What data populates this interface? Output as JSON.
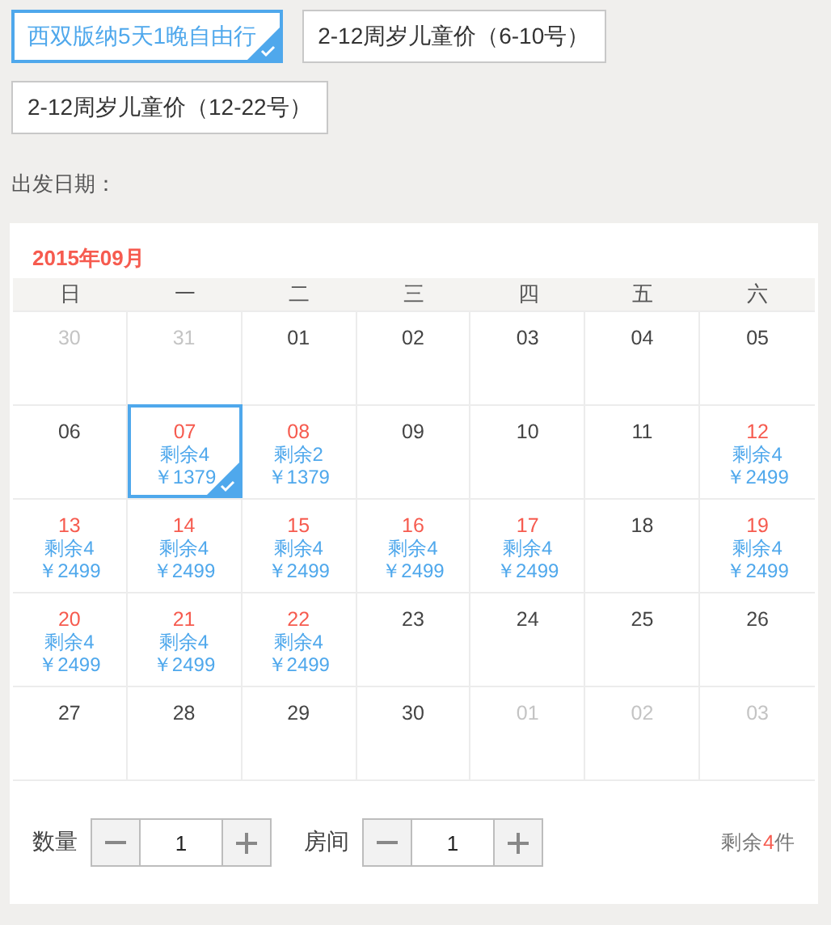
{
  "packages": [
    {
      "label": "西双版纳5天1晚自由行",
      "selected": true
    },
    {
      "label": "2-12周岁儿童价（6-10号）",
      "selected": false
    },
    {
      "label": "2-12周岁儿童价（12-22号）",
      "selected": false
    }
  ],
  "departure_label": "出发日期：",
  "calendar": {
    "month": "2015年09月",
    "weekdays": [
      "日",
      "一",
      "二",
      "三",
      "四",
      "五",
      "六"
    ],
    "weeks": [
      [
        {
          "day": "30",
          "kind": "other_month",
          "selected": false
        },
        {
          "day": "31",
          "kind": "other_month",
          "selected": false
        },
        {
          "day": "01",
          "kind": "plain",
          "selected": false
        },
        {
          "day": "02",
          "kind": "plain",
          "selected": false
        },
        {
          "day": "03",
          "kind": "plain",
          "selected": false
        },
        {
          "day": "04",
          "kind": "plain",
          "selected": false
        },
        {
          "day": "05",
          "kind": "plain",
          "selected": false
        }
      ],
      [
        {
          "day": "06",
          "kind": "plain",
          "selected": false
        },
        {
          "day": "07",
          "kind": "available",
          "remaining": "剩余4",
          "price": "￥1379",
          "selected": true
        },
        {
          "day": "08",
          "kind": "available",
          "remaining": "剩余2",
          "price": "￥1379",
          "selected": false
        },
        {
          "day": "09",
          "kind": "plain",
          "selected": false
        },
        {
          "day": "10",
          "kind": "plain",
          "selected": false
        },
        {
          "day": "11",
          "kind": "plain",
          "selected": false
        },
        {
          "day": "12",
          "kind": "available",
          "remaining": "剩余4",
          "price": "￥2499",
          "selected": false
        }
      ],
      [
        {
          "day": "13",
          "kind": "available",
          "remaining": "剩余4",
          "price": "￥2499",
          "selected": false
        },
        {
          "day": "14",
          "kind": "available",
          "remaining": "剩余4",
          "price": "￥2499",
          "selected": false
        },
        {
          "day": "15",
          "kind": "available",
          "remaining": "剩余4",
          "price": "￥2499",
          "selected": false
        },
        {
          "day": "16",
          "kind": "available",
          "remaining": "剩余4",
          "price": "￥2499",
          "selected": false
        },
        {
          "day": "17",
          "kind": "available",
          "remaining": "剩余4",
          "price": "￥2499",
          "selected": false
        },
        {
          "day": "18",
          "kind": "plain",
          "selected": false
        },
        {
          "day": "19",
          "kind": "available",
          "remaining": "剩余4",
          "price": "￥2499",
          "selected": false
        }
      ],
      [
        {
          "day": "20",
          "kind": "available",
          "remaining": "剩余4",
          "price": "￥2499",
          "selected": false
        },
        {
          "day": "21",
          "kind": "available",
          "remaining": "剩余4",
          "price": "￥2499",
          "selected": false
        },
        {
          "day": "22",
          "kind": "available",
          "remaining": "剩余4",
          "price": "￥2499",
          "selected": false
        },
        {
          "day": "23",
          "kind": "plain",
          "selected": false
        },
        {
          "day": "24",
          "kind": "plain",
          "selected": false
        },
        {
          "day": "25",
          "kind": "plain",
          "selected": false
        },
        {
          "day": "26",
          "kind": "plain",
          "selected": false
        }
      ],
      [
        {
          "day": "27",
          "kind": "plain",
          "selected": false
        },
        {
          "day": "28",
          "kind": "plain",
          "selected": false
        },
        {
          "day": "29",
          "kind": "plain",
          "selected": false
        },
        {
          "day": "30",
          "kind": "plain",
          "selected": false
        },
        {
          "day": "01",
          "kind": "other_month",
          "selected": false
        },
        {
          "day": "02",
          "kind": "other_month",
          "selected": false
        },
        {
          "day": "03",
          "kind": "other_month",
          "selected": false
        }
      ]
    ]
  },
  "footer": {
    "steppers": [
      {
        "label": "数量",
        "value": "1"
      },
      {
        "label": "房间",
        "value": "1"
      }
    ],
    "stock": {
      "prefix": "剩余",
      "count": "4",
      "suffix": "件"
    }
  }
}
